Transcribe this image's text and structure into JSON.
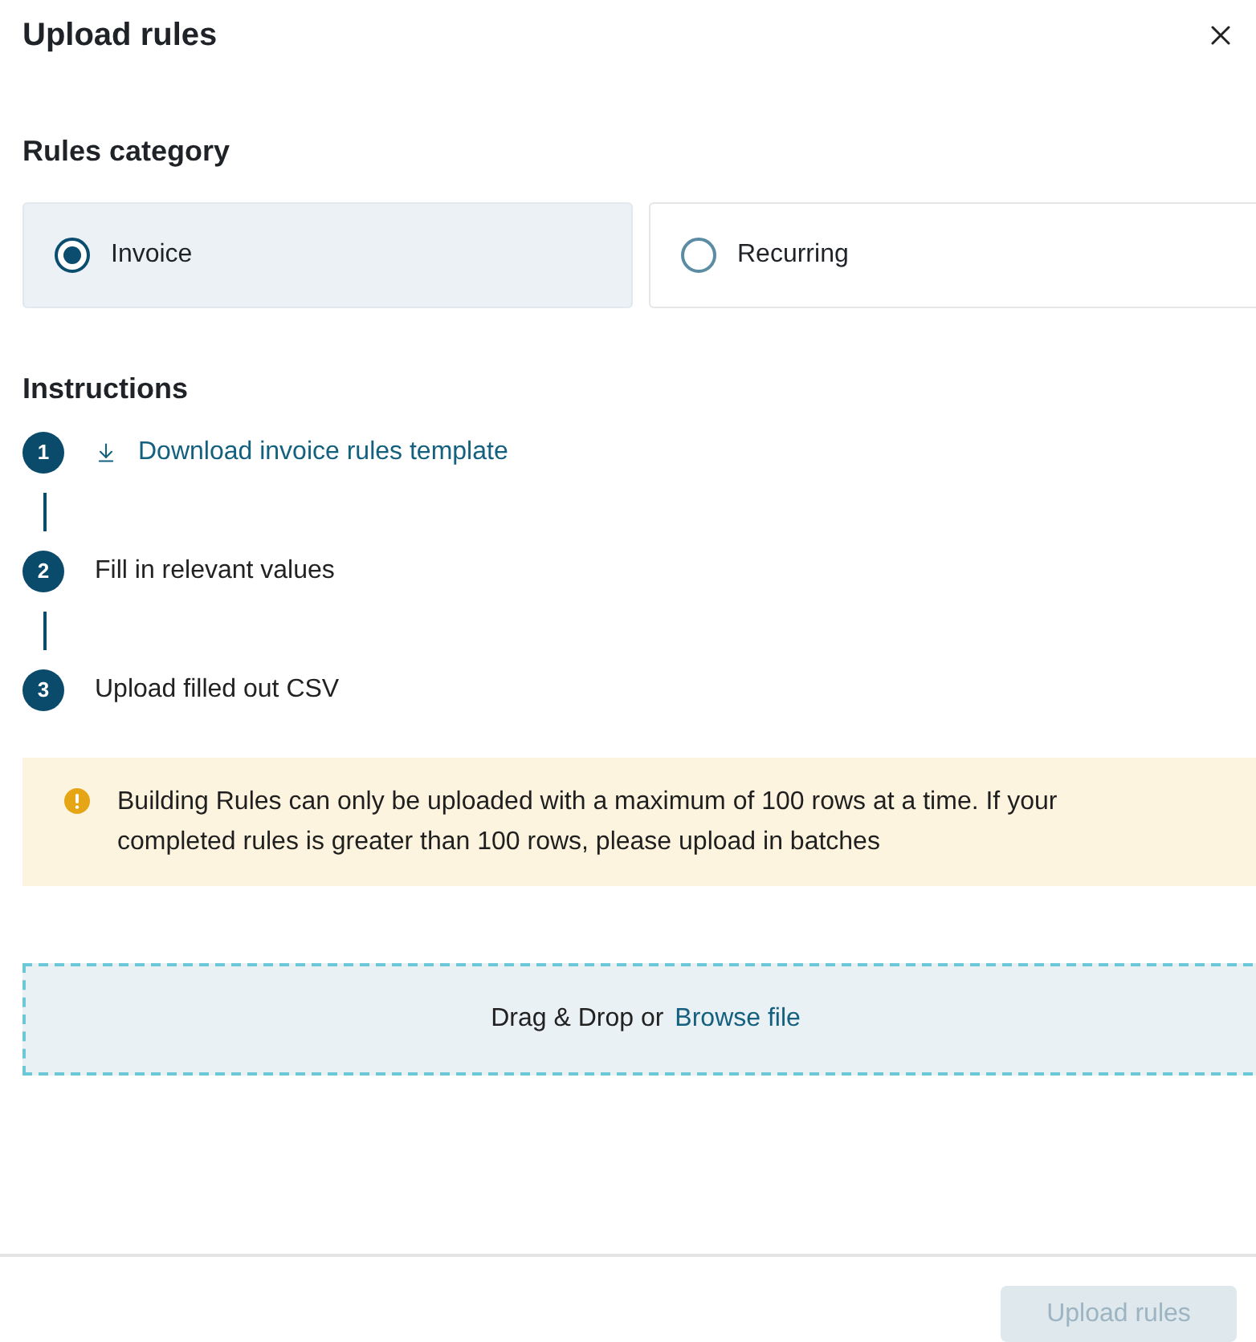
{
  "dialog": {
    "title": "Upload rules"
  },
  "rules_category": {
    "heading": "Rules category",
    "options": [
      {
        "label": "Invoice",
        "selected": true
      },
      {
        "label": "Recurring",
        "selected": false
      }
    ]
  },
  "instructions": {
    "heading": "Instructions",
    "steps": [
      {
        "number": "1",
        "kind": "link",
        "text": "Download invoice rules template"
      },
      {
        "number": "2",
        "kind": "text",
        "text": "Fill in relevant values"
      },
      {
        "number": "3",
        "kind": "text",
        "text": "Upload filled out CSV"
      }
    ]
  },
  "warning": {
    "text": "Building Rules can only be uploaded with a maximum of 100 rows at a time. If your completed rules is greater than 100 rows, please upload in batches"
  },
  "dropzone": {
    "text": "Drag & Drop or",
    "link": "Browse file"
  },
  "footer": {
    "upload_button": {
      "label": "Upload rules",
      "disabled": true
    }
  }
}
